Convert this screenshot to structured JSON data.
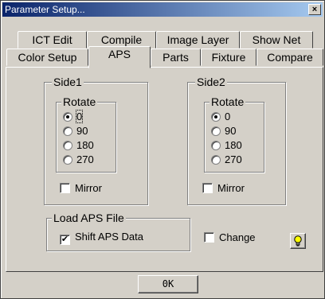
{
  "window": {
    "title": "Parameter Setup...",
    "close_glyph": "×"
  },
  "tabs_back": [
    {
      "label": "ICT Edit"
    },
    {
      "label": "Compile"
    },
    {
      "label": "Image Layer"
    },
    {
      "label": "Show Net"
    }
  ],
  "tabs_front": [
    {
      "label": "Color Setup"
    },
    {
      "label": "APS",
      "active": true
    },
    {
      "label": "Parts"
    },
    {
      "label": "Fixture"
    },
    {
      "label": "Compare"
    }
  ],
  "side1": {
    "title": "Side1",
    "rotate_title": "Rotate",
    "options": [
      "0",
      "90",
      "180",
      "270"
    ],
    "selected": "0",
    "mirror_label": "Mirror",
    "mirror_checked": false
  },
  "side2": {
    "title": "Side2",
    "rotate_title": "Rotate",
    "options": [
      "0",
      "90",
      "180",
      "270"
    ],
    "selected": "0",
    "mirror_label": "Mirror",
    "mirror_checked": false
  },
  "load_aps": {
    "title": "Load APS File",
    "shift_label": "Shift APS Data",
    "shift_checked": true
  },
  "change": {
    "label": "Change",
    "checked": false
  },
  "icons": {
    "bulb": "lightbulb-icon"
  },
  "colors": {
    "face": "#d4d0c8",
    "title_start": "#0a246a",
    "title_end": "#a6caf0",
    "bulb": "#ffff00"
  },
  "ok_button": {
    "label": "0K"
  }
}
